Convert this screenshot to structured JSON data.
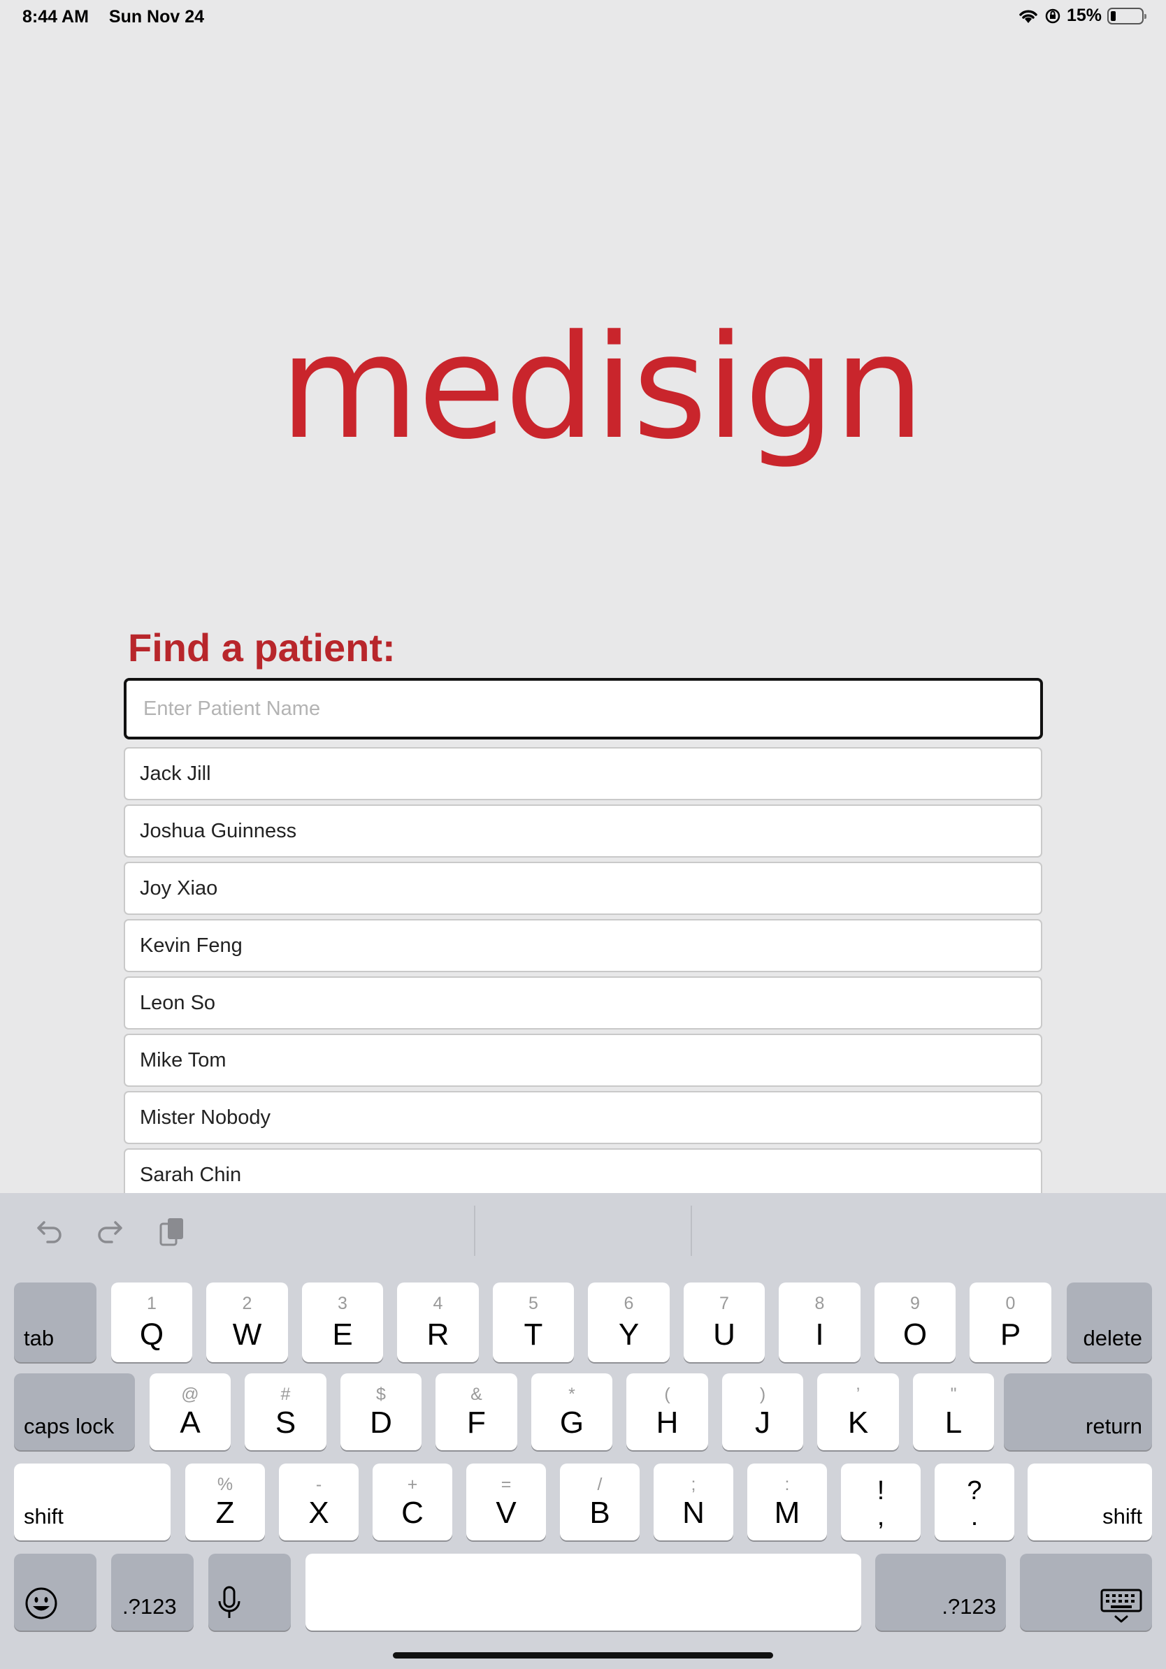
{
  "status_bar": {
    "time": "8:44 AM",
    "date": "Sun Nov 24",
    "battery": "15%",
    "battery_level": 0.15
  },
  "logo": {
    "text": "medisign",
    "color": "#c9252c"
  },
  "search": {
    "title": "Find a patient:",
    "placeholder": "Enter Patient Name",
    "value": ""
  },
  "patients": [
    "Jack Jill",
    "Joshua Guinness",
    "Joy Xiao",
    "Kevin Feng",
    "Leon So",
    "Mike Tom",
    "Mister Nobody",
    "Sarah Chin"
  ],
  "keyboard": {
    "toolbar": [
      "undo-icon",
      "redo-icon",
      "paste-icon"
    ],
    "row1": [
      {
        "main": "Q",
        "sec": "1"
      },
      {
        "main": "W",
        "sec": "2"
      },
      {
        "main": "E",
        "sec": "3"
      },
      {
        "main": "R",
        "sec": "4"
      },
      {
        "main": "T",
        "sec": "5"
      },
      {
        "main": "Y",
        "sec": "6"
      },
      {
        "main": "U",
        "sec": "7"
      },
      {
        "main": "I",
        "sec": "8"
      },
      {
        "main": "O",
        "sec": "9"
      },
      {
        "main": "P",
        "sec": "0"
      }
    ],
    "row2": [
      {
        "main": "A",
        "sec": "@"
      },
      {
        "main": "S",
        "sec": "#"
      },
      {
        "main": "D",
        "sec": "$"
      },
      {
        "main": "F",
        "sec": "&"
      },
      {
        "main": "G",
        "sec": "*"
      },
      {
        "main": "H",
        "sec": "("
      },
      {
        "main": "J",
        "sec": ")"
      },
      {
        "main": "K",
        "sec": "’"
      },
      {
        "main": "L",
        "sec": "\""
      }
    ],
    "row3": [
      {
        "main": "Z",
        "sec": "%"
      },
      {
        "main": "X",
        "sec": "-"
      },
      {
        "main": "C",
        "sec": "+"
      },
      {
        "main": "V",
        "sec": "="
      },
      {
        "main": "B",
        "sec": "/"
      },
      {
        "main": "N",
        "sec": ";"
      },
      {
        "main": "M",
        "sec": ":"
      }
    ],
    "row3_punct": [
      {
        "top": "!",
        "bot": ","
      },
      {
        "top": "?",
        "bot": "."
      }
    ],
    "labels": {
      "tab": "tab",
      "delete": "delete",
      "caps_lock": "caps lock",
      "return": "return",
      "shift": "shift",
      "numbers": ".?123"
    }
  }
}
